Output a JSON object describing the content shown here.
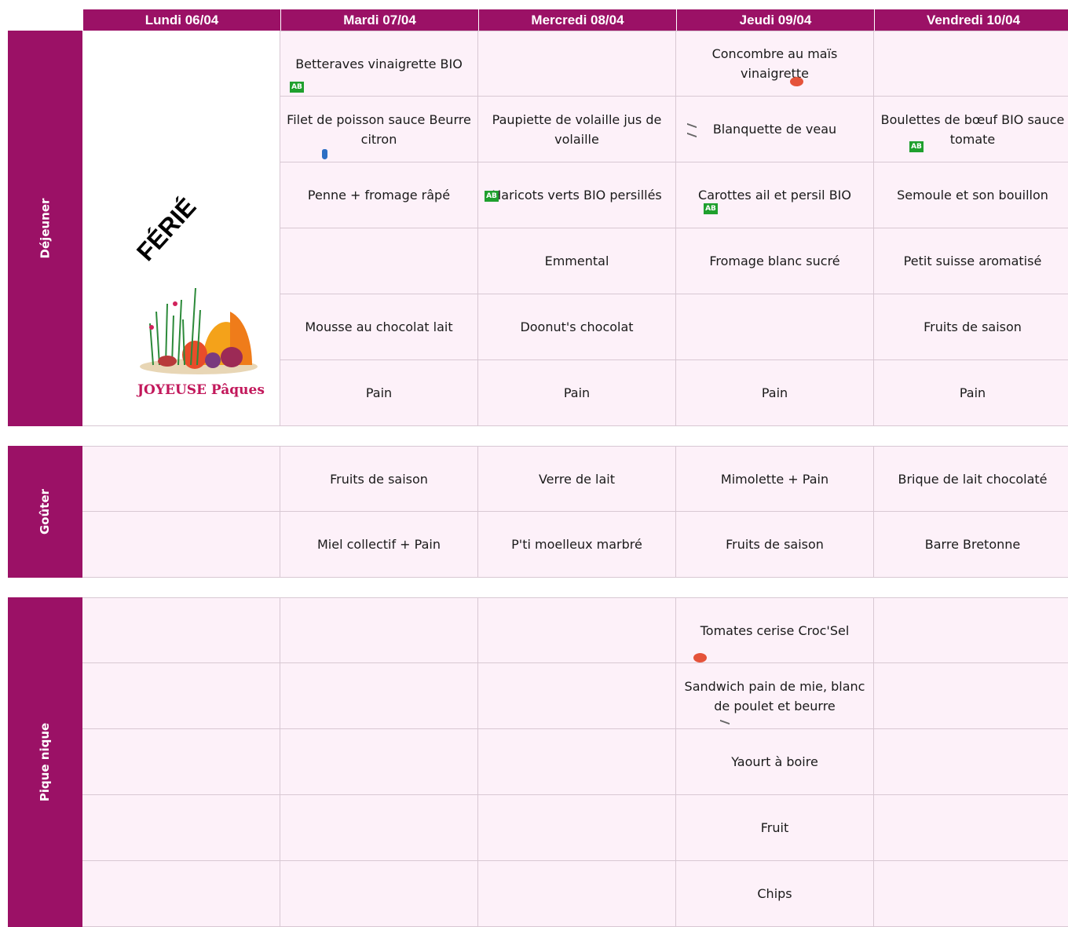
{
  "days": [
    "Lundi 06/04",
    "Mardi 07/04",
    "Mercredi 08/04",
    "Jeudi 09/04",
    "Vendredi 10/04"
  ],
  "sections": {
    "dejeuner": {
      "label": "Déjeuner",
      "holiday": "FÉRIÉ",
      "easter_text": "JOYEUSE Pâques",
      "rows": [
        [
          "Betteraves vinaigrette BIO",
          "",
          "Concombre au maïs vinaigrette",
          ""
        ],
        [
          "Filet de poisson sauce Beurre citron",
          "Paupiette de volaille jus de volaille",
          "Blanquette de veau",
          "Boulettes de bœuf BIO sauce tomate"
        ],
        [
          "Penne  + fromage râpé",
          "Haricots verts BIO persillés",
          "Carottes ail et persil BIO",
          "Semoule et son bouillon"
        ],
        [
          "",
          "Emmental",
          "Fromage blanc sucré",
          "Petit suisse aromatisé"
        ],
        [
          "Mousse au chocolat lait",
          "Doonut's chocolat",
          "",
          "Fruits de saison"
        ],
        [
          "Pain",
          "Pain",
          "Pain",
          "Pain"
        ]
      ]
    },
    "gouter": {
      "label": "Goûter",
      "rows": [
        [
          "",
          "Fruits de saison",
          "Verre de lait",
          "Mimolette  + Pain",
          "Brique de lait chocolaté"
        ],
        [
          "",
          "Miel collectif + Pain",
          "P'ti moelleux marbré",
          "Fruits de saison",
          "Barre Bretonne"
        ]
      ]
    },
    "pique_nique": {
      "label": "Pique nique",
      "rows": [
        [
          "",
          "",
          "",
          "Tomates cerise Croc'Sel",
          ""
        ],
        [
          "",
          "",
          "",
          "Sandwich pain de mie, blanc de poulet et beurre",
          ""
        ],
        [
          "",
          "",
          "",
          "Yaourt à boire",
          ""
        ],
        [
          "",
          "",
          "",
          "Fruit",
          ""
        ],
        [
          "",
          "",
          "",
          "Chips",
          ""
        ]
      ]
    }
  },
  "icons": {
    "organic": "ab-organic-icon",
    "tomato": "tomato-icon",
    "fish": "fish-label-icon",
    "drop": "water-drop-icon"
  },
  "colors": {
    "accent": "#9b1166",
    "cell_bg": "#fdf1f9"
  }
}
